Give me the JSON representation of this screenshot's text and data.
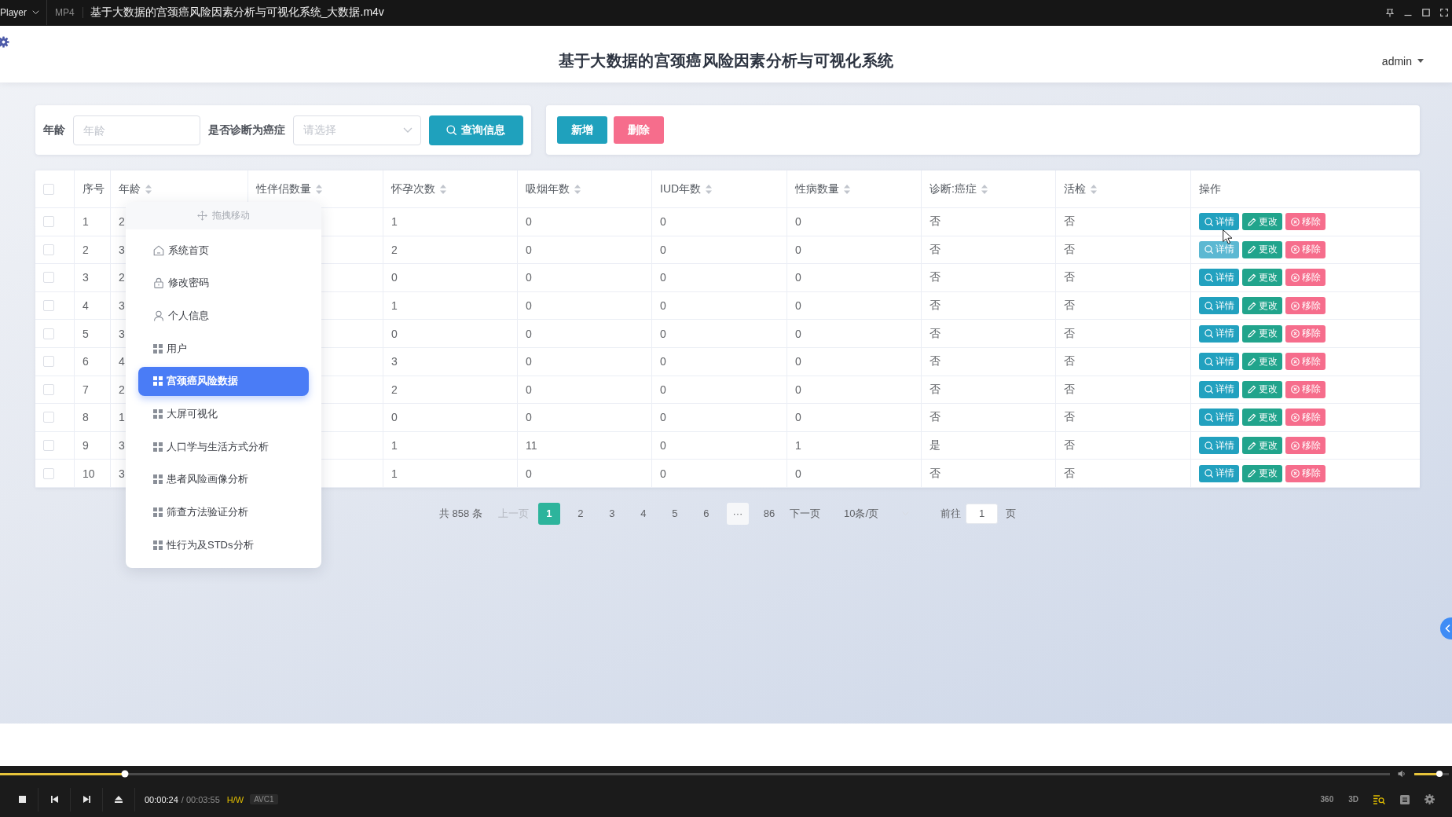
{
  "player": {
    "menu": "Player",
    "format": "MP4",
    "file_title": "基于大数据的宫颈癌风险因素分析与可视化系统_大数据.m4v"
  },
  "header": {
    "title": "基于大数据的宫颈癌风险因素分析与可视化系统",
    "user": "admin"
  },
  "filters": [
    {
      "kind": "input",
      "label": "年龄",
      "placeholder": "年龄"
    },
    {
      "kind": "select",
      "label": "是否诊断为癌症",
      "placeholder": "请选择"
    }
  ],
  "search_button": "查询信息",
  "actions": [
    {
      "kind": "add",
      "label": "新增"
    },
    {
      "kind": "delete",
      "label": "删除"
    }
  ],
  "table": {
    "all_checked": false,
    "columns": [
      {
        "label": "序号",
        "sortable": false
      },
      {
        "label": "年龄",
        "sortable": true
      },
      {
        "label": "性伴侣数量",
        "sortable": true
      },
      {
        "label": "怀孕次数",
        "sortable": true
      },
      {
        "label": "吸烟年数",
        "sortable": true
      },
      {
        "label": "IUD年数",
        "sortable": true
      },
      {
        "label": "性病数量",
        "sortable": true
      },
      {
        "label": "诊断:癌症",
        "sortable": true
      },
      {
        "label": "活检",
        "sortable": true
      },
      {
        "label": "操作",
        "sortable": false
      }
    ],
    "rows": [
      {
        "checked": false,
        "no": "1",
        "age": "2",
        "pregnancies": "1",
        "smoking_years": "0",
        "iud_years": "0",
        "std_count": "0",
        "cancer": "否",
        "biopsy": "否",
        "actions": [
          {
            "kind": "detail",
            "label": "详情",
            "hovered": false
          },
          {
            "kind": "edit",
            "label": "更改",
            "hovered": false
          },
          {
            "kind": "remove",
            "label": "移除",
            "hovered": false
          }
        ]
      },
      {
        "checked": false,
        "no": "2",
        "age": "3",
        "pregnancies": "2",
        "smoking_years": "0",
        "iud_years": "0",
        "std_count": "0",
        "cancer": "否",
        "biopsy": "否",
        "actions": [
          {
            "kind": "detail",
            "label": "详情",
            "hovered": true
          },
          {
            "kind": "edit",
            "label": "更改",
            "hovered": false
          },
          {
            "kind": "remove",
            "label": "移除",
            "hovered": false
          }
        ]
      },
      {
        "checked": false,
        "no": "3",
        "age": "2",
        "pregnancies": "0",
        "smoking_years": "0",
        "iud_years": "0",
        "std_count": "0",
        "cancer": "否",
        "biopsy": "否",
        "actions": [
          {
            "kind": "detail",
            "label": "详情",
            "hovered": false
          },
          {
            "kind": "edit",
            "label": "更改",
            "hovered": false
          },
          {
            "kind": "remove",
            "label": "移除",
            "hovered": false
          }
        ]
      },
      {
        "checked": false,
        "no": "4",
        "age": "3",
        "pregnancies": "1",
        "smoking_years": "0",
        "iud_years": "0",
        "std_count": "0",
        "cancer": "否",
        "biopsy": "否",
        "actions": [
          {
            "kind": "detail",
            "label": "详情",
            "hovered": false
          },
          {
            "kind": "edit",
            "label": "更改",
            "hovered": false
          },
          {
            "kind": "remove",
            "label": "移除",
            "hovered": false
          }
        ]
      },
      {
        "checked": false,
        "no": "5",
        "age": "3",
        "pregnancies": "0",
        "smoking_years": "0",
        "iud_years": "0",
        "std_count": "0",
        "cancer": "否",
        "biopsy": "否",
        "actions": [
          {
            "kind": "detail",
            "label": "详情",
            "hovered": false
          },
          {
            "kind": "edit",
            "label": "更改",
            "hovered": false
          },
          {
            "kind": "remove",
            "label": "移除",
            "hovered": false
          }
        ]
      },
      {
        "checked": false,
        "no": "6",
        "age": "4",
        "pregnancies": "3",
        "smoking_years": "0",
        "iud_years": "0",
        "std_count": "0",
        "cancer": "否",
        "biopsy": "否",
        "actions": [
          {
            "kind": "detail",
            "label": "详情",
            "hovered": false
          },
          {
            "kind": "edit",
            "label": "更改",
            "hovered": false
          },
          {
            "kind": "remove",
            "label": "移除",
            "hovered": false
          }
        ]
      },
      {
        "checked": false,
        "no": "7",
        "age": "2",
        "pregnancies": "2",
        "smoking_years": "0",
        "iud_years": "0",
        "std_count": "0",
        "cancer": "否",
        "biopsy": "否",
        "actions": [
          {
            "kind": "detail",
            "label": "详情",
            "hovered": false
          },
          {
            "kind": "edit",
            "label": "更改",
            "hovered": false
          },
          {
            "kind": "remove",
            "label": "移除",
            "hovered": false
          }
        ]
      },
      {
        "checked": false,
        "no": "8",
        "age": "1",
        "pregnancies": "0",
        "smoking_years": "0",
        "iud_years": "0",
        "std_count": "0",
        "cancer": "否",
        "biopsy": "否",
        "actions": [
          {
            "kind": "detail",
            "label": "详情",
            "hovered": false
          },
          {
            "kind": "edit",
            "label": "更改",
            "hovered": false
          },
          {
            "kind": "remove",
            "label": "移除",
            "hovered": false
          }
        ]
      },
      {
        "checked": false,
        "no": "9",
        "age": "3",
        "pregnancies": "1",
        "smoking_years": "11",
        "iud_years": "0",
        "std_count": "1",
        "cancer": "是",
        "biopsy": "否",
        "actions": [
          {
            "kind": "detail",
            "label": "详情",
            "hovered": false
          },
          {
            "kind": "edit",
            "label": "更改",
            "hovered": false
          },
          {
            "kind": "remove",
            "label": "移除",
            "hovered": false
          }
        ]
      },
      {
        "checked": false,
        "no": "10",
        "age": "3",
        "pregnancies": "1",
        "smoking_years": "0",
        "iud_years": "0",
        "std_count": "0",
        "cancer": "否",
        "biopsy": "否",
        "actions": [
          {
            "kind": "detail",
            "label": "详情",
            "hovered": false
          },
          {
            "kind": "edit",
            "label": "更改",
            "hovered": false
          },
          {
            "kind": "remove",
            "label": "移除",
            "hovered": false
          }
        ]
      }
    ]
  },
  "menu": {
    "handle": "拖拽移动",
    "items": [
      {
        "kind": "home",
        "label": "系统首页",
        "selected": false
      },
      {
        "kind": "password",
        "label": "修改密码",
        "selected": false
      },
      {
        "kind": "profile",
        "label": "个人信息",
        "selected": false
      },
      {
        "kind": "module",
        "label": "用户",
        "selected": false
      },
      {
        "kind": "module",
        "label": "宫颈癌风险数据",
        "selected": true
      },
      {
        "kind": "module",
        "label": "大屏可视化",
        "selected": false
      },
      {
        "kind": "module",
        "label": "人口学与生活方式分析",
        "selected": false
      },
      {
        "kind": "module",
        "label": "患者风险画像分析",
        "selected": false
      },
      {
        "kind": "module",
        "label": "筛查方法验证分析",
        "selected": false
      },
      {
        "kind": "module",
        "label": "性行为及STDs分析",
        "selected": false
      }
    ]
  },
  "pagination": {
    "total": "共 858 条",
    "prev": {
      "label": "上一页",
      "disabled": true
    },
    "pages": [
      {
        "kind": "page",
        "label": "1",
        "selected": true
      },
      {
        "kind": "page",
        "label": "2",
        "selected": false
      },
      {
        "kind": "page",
        "label": "3",
        "selected": false
      },
      {
        "kind": "page",
        "label": "4",
        "selected": false
      },
      {
        "kind": "page",
        "label": "5",
        "selected": false
      },
      {
        "kind": "page",
        "label": "6",
        "selected": false
      },
      {
        "kind": "more",
        "label": "···",
        "selected": false
      },
      {
        "kind": "page",
        "label": "86",
        "selected": false
      }
    ],
    "next": {
      "label": "下一页",
      "disabled": false
    },
    "page_size": "10条/页",
    "goto": {
      "label": "前往",
      "value": "1",
      "suffix": "页"
    }
  },
  "player_bar": {
    "progress": {
      "level": 0.09
    },
    "volume": {
      "level": 0.73
    },
    "elapsed": "00:00:24",
    "total": "/ 00:03:55",
    "decoder": "H/W",
    "codec": "AVC1",
    "view_modes": [
      "360",
      "3D"
    ]
  }
}
